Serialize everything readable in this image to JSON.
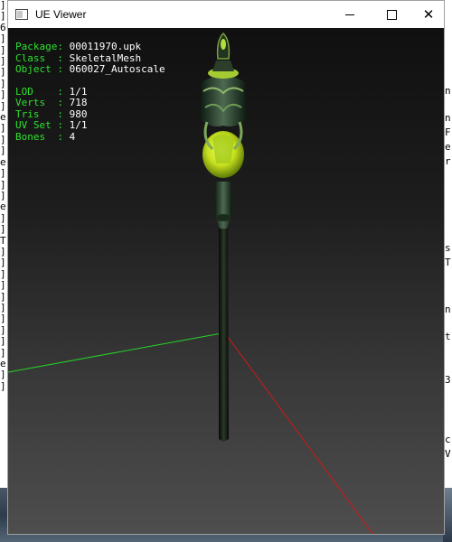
{
  "window": {
    "title": "UE Viewer",
    "buttons": {
      "minimize": "minimize",
      "maximize": "maximize",
      "close": "✕"
    }
  },
  "info": {
    "package": {
      "key": "Package: ",
      "value": "00011970.upk"
    },
    "class": {
      "key": "Class  : ",
      "value": "SkeletalMesh"
    },
    "object": {
      "key": "Object : ",
      "value": "060027_Autoscale"
    },
    "lod": {
      "key": "LOD    : ",
      "value": "1/1"
    },
    "verts": {
      "key": "Verts  : ",
      "value": "718"
    },
    "tris": {
      "key": "Tris   : ",
      "value": "980"
    },
    "uvset": {
      "key": "UV Set : ",
      "value": "1/1"
    },
    "bones": {
      "key": "Bones  : ",
      "value": "4"
    }
  },
  "background_console": {
    "left_chars": [
      "]",
      "]",
      "6",
      "]",
      "]",
      "]",
      "]",
      "]",
      "]",
      "]",
      "e",
      "]",
      "]",
      "]",
      "e",
      "]",
      "]",
      "]",
      "e",
      "]",
      "]",
      "T",
      "]",
      "]",
      "]",
      "]",
      "]",
      "]",
      "]",
      "]",
      "]",
      "]",
      "e",
      "]",
      "]"
    ],
    "right_chars": [
      "n",
      "n",
      "F",
      "e",
      "r",
      "s",
      "T",
      "n",
      "t",
      "3",
      "c",
      "V"
    ]
  },
  "colors": {
    "axis_green": "#27d427",
    "axis_red": "#d01818",
    "info_key": "#2fe12f",
    "info_value": "#ffffff",
    "gem": "#c8e11e"
  }
}
